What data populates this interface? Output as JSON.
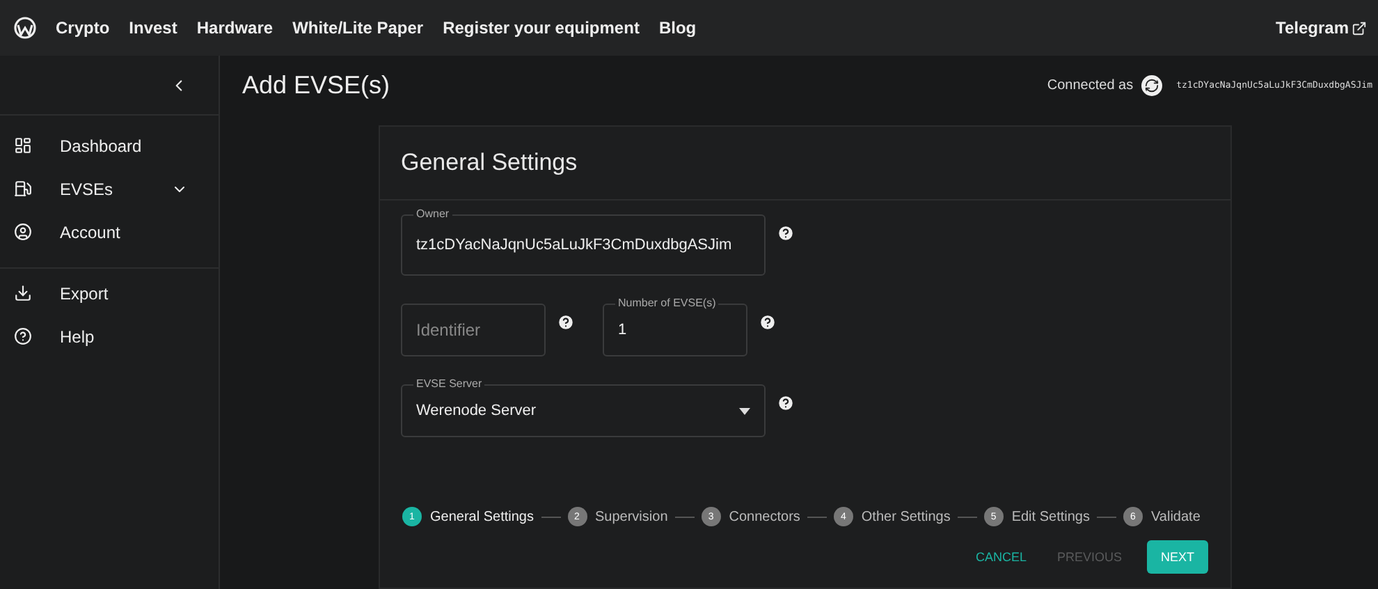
{
  "topnav": {
    "links": [
      "Crypto",
      "Invest",
      "Hardware",
      "White/Lite Paper",
      "Register your equipment",
      "Blog"
    ],
    "external": "Telegram"
  },
  "sidebar": {
    "items": [
      {
        "label": "Dashboard",
        "kind": "dashboard",
        "expandable": false,
        "divider_before": false
      },
      {
        "label": "EVSEs",
        "kind": "evse",
        "expandable": true,
        "divider_before": false
      },
      {
        "label": "Account",
        "kind": "account",
        "expandable": false,
        "divider_before": false
      },
      {
        "label": "Export",
        "kind": "export",
        "expandable": false,
        "divider_before": true
      },
      {
        "label": "Help",
        "kind": "help",
        "expandable": false,
        "divider_before": false
      }
    ]
  },
  "page": {
    "title": "Add EVSE(s)",
    "connected_label": "Connected as",
    "address": "tz1cDYacNaJqnUc5aLuJkF3CmDuxdbgASJim"
  },
  "card": {
    "title": "General Settings",
    "fields": [
      {
        "kind": "text",
        "label": "Owner",
        "value": "tz1cDYacNaJqnUc5aLuJkF3CmDuxdbgASJim",
        "half": false
      },
      {
        "kind": "text",
        "placeholder": "Identifier",
        "half": true
      },
      {
        "kind": "text",
        "label": "Number of EVSE(s)",
        "value": "1",
        "half": true
      },
      {
        "kind": "select",
        "label": "EVSE Server",
        "value": "Werenode Server",
        "half": false
      }
    ],
    "steps": [
      {
        "number": "1",
        "label": "General Settings",
        "selected": true
      },
      {
        "number": "2",
        "label": "Supervision",
        "selected": false
      },
      {
        "number": "3",
        "label": "Connectors",
        "selected": false
      },
      {
        "number": "4",
        "label": "Other Settings",
        "selected": false
      },
      {
        "number": "5",
        "label": "Edit Settings",
        "selected": false
      },
      {
        "number": "6",
        "label": "Validate",
        "selected": false
      }
    ],
    "buttons": [
      {
        "label": "CANCEL",
        "kind": "text",
        "disabled": false
      },
      {
        "label": "PREVIOUS",
        "kind": "text",
        "disabled": true
      },
      {
        "label": "NEXT",
        "kind": "contained",
        "disabled": false
      }
    ]
  }
}
